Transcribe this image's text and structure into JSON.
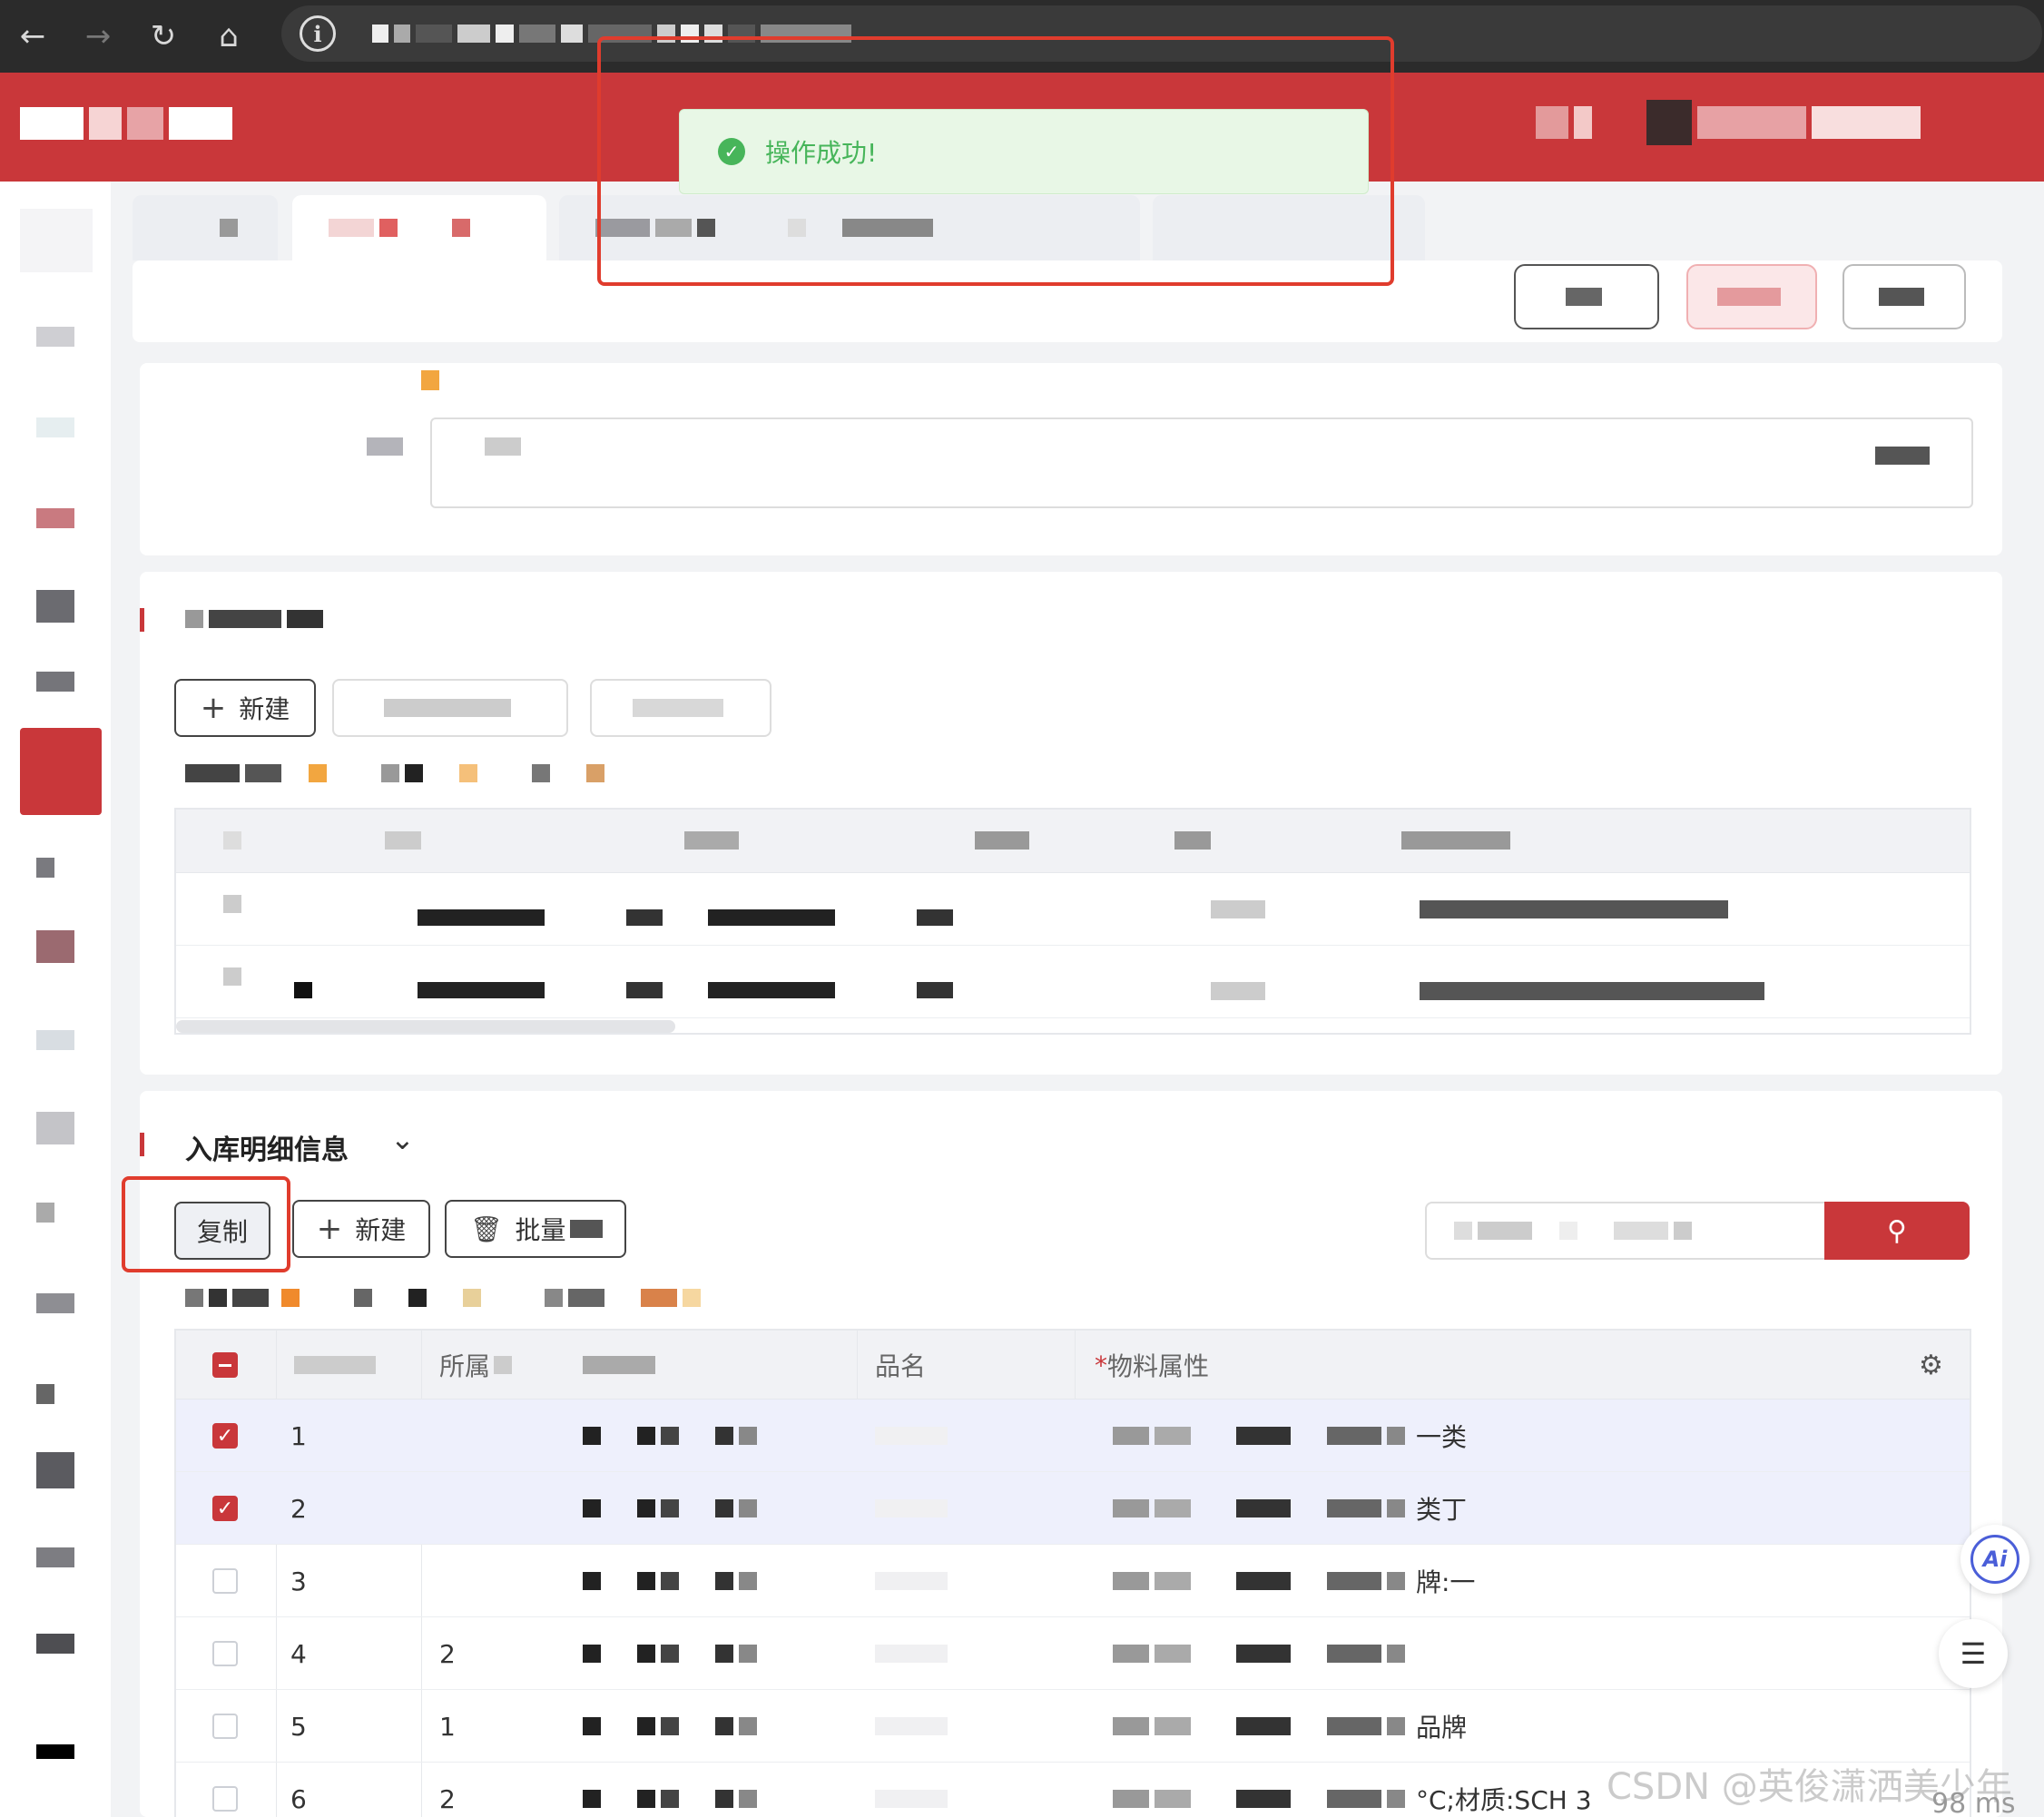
{
  "toast": {
    "message": "操作成功!"
  },
  "colors": {
    "brand": "#c9373a",
    "success": "#47b55a",
    "highlight": "#e03c2d"
  },
  "section1": {
    "new_label": "新建"
  },
  "section2": {
    "title": "入库明细信息",
    "copy_label": "复制",
    "new_label": "新建",
    "batch_label": "批量",
    "columns": {
      "col2": "所属",
      "col4": "品名",
      "col5_required_mark": "*",
      "col5": "物料属性"
    },
    "rows": [
      {
        "index": "1",
        "col2": "",
        "selected": true,
        "attr_tail": "一类"
      },
      {
        "index": "2",
        "col2": "",
        "selected": true,
        "attr_tail": "类丁"
      },
      {
        "index": "3",
        "col2": "",
        "selected": false,
        "attr_tail": "牌:一"
      },
      {
        "index": "4",
        "col2": "2",
        "selected": false,
        "attr_tail": ""
      },
      {
        "index": "5",
        "col2": "1",
        "selected": false,
        "attr_tail": "品牌"
      },
      {
        "index": "6",
        "col2": "2",
        "selected": false,
        "attr_tail": "°C;材质:SCH 3"
      }
    ]
  },
  "floating": {
    "ai_label": "Ai"
  },
  "watermark": "CSDN @英俊潇洒美少年",
  "latency": "98 ms"
}
